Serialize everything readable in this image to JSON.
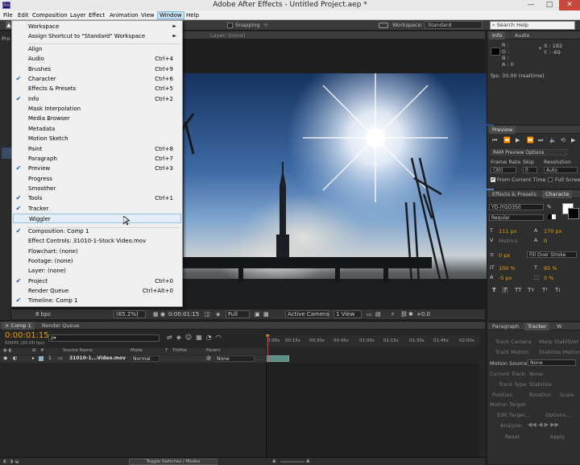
{
  "title_bar": {
    "title": "Adobe After Effects - Untitled Project.aep *",
    "minimize": "—",
    "maximize": "□",
    "close": "✕"
  },
  "menu_bar": [
    "File",
    "Edit",
    "Composition",
    "Layer",
    "Effect",
    "Animation",
    "View",
    "Window",
    "Help"
  ],
  "toolbar": {
    "snapping": "Snapping",
    "workspace_label": "Workspace:",
    "workspace_value": "Standard",
    "search_placeholder": "Search Help"
  },
  "window_menu": {
    "workspace": "Workspace",
    "assign_shortcut": "Assign Shortcut to \"Standard\" Workspace",
    "items": [
      {
        "label": "Align",
        "shortcut": "",
        "checked": false
      },
      {
        "label": "Audio",
        "shortcut": "Ctrl+4",
        "checked": false
      },
      {
        "label": "Brushes",
        "shortcut": "Ctrl+9",
        "checked": false
      },
      {
        "label": "Character",
        "shortcut": "Ctrl+6",
        "checked": true
      },
      {
        "label": "Effects & Presets",
        "shortcut": "Ctrl+5",
        "checked": false
      },
      {
        "label": "Info",
        "shortcut": "Ctrl+2",
        "checked": true
      },
      {
        "label": "Mask Interpolation",
        "shortcut": "",
        "checked": false
      },
      {
        "label": "Media Browser",
        "shortcut": "",
        "checked": false
      },
      {
        "label": "Metadata",
        "shortcut": "",
        "checked": false
      },
      {
        "label": "Motion Sketch",
        "shortcut": "",
        "checked": false
      },
      {
        "label": "Paint",
        "shortcut": "Ctrl+8",
        "checked": false
      },
      {
        "label": "Paragraph",
        "shortcut": "Ctrl+7",
        "checked": false
      },
      {
        "label": "Preview",
        "shortcut": "Ctrl+3",
        "checked": true
      },
      {
        "label": "Progress",
        "shortcut": "",
        "checked": false
      },
      {
        "label": "Smoother",
        "shortcut": "",
        "checked": false
      },
      {
        "label": "Tools",
        "shortcut": "Ctrl+1",
        "checked": true
      },
      {
        "label": "Tracker",
        "shortcut": "",
        "checked": true
      },
      {
        "label": "Wiggler",
        "shortcut": "",
        "checked": false
      }
    ],
    "items2": [
      {
        "label": "Composition: Comp 1",
        "shortcut": "",
        "checked": true
      },
      {
        "label": "Effect Controls: 31010-1-Stock Video.mov",
        "shortcut": "",
        "checked": false
      },
      {
        "label": "Flowchart: (none)",
        "shortcut": "",
        "checked": false
      },
      {
        "label": "Footage: (none)",
        "shortcut": "",
        "checked": false
      },
      {
        "label": "Layer: (none)",
        "shortcut": "",
        "checked": false
      },
      {
        "label": "Project",
        "shortcut": "Ctrl+0",
        "checked": true
      },
      {
        "label": "Render Queue",
        "shortcut": "Ctrl+Alt+0",
        "checked": false
      },
      {
        "label": "Timeline: Comp 1",
        "shortcut": "",
        "checked": true
      }
    ]
  },
  "viewer": {
    "layer_tab": "Layer: (none)",
    "bpc": "8 bpc",
    "zoom": "(65.2%)",
    "timecode": "0:00:01:15",
    "resolution": "Full",
    "camera": "Active Camera",
    "view": "1 View",
    "exposure": "+0.0"
  },
  "info_panel": {
    "tabs": [
      "Info",
      "Audio"
    ],
    "r": "R :",
    "g": "G :",
    "b": "B :",
    "a": "A : 0",
    "x": "X : 182",
    "y": "Y : -69",
    "fps": "fps: 30.00 (realtime)"
  },
  "preview_panel": {
    "tab": "Preview",
    "ram_preview": "RAM Preview Options",
    "frame_rate_label": "Frame Rate",
    "skip_label": "Skip",
    "resolution_label": "Resolution",
    "frame_rate": "(30)",
    "skip": "0",
    "resolution": "Auto",
    "from_current": "From Current Time",
    "full_screen": "Full Screen"
  },
  "character_panel": {
    "tabs": [
      "Effects & Presets",
      "Characte"
    ],
    "font": "YD-IYGO350",
    "style": "Regular",
    "size": "111 px",
    "leading": "170 px",
    "tracking": "0",
    "metrics": "Metrics",
    "stroke_width": "0 px",
    "stroke_type": "Fill Over Stroke",
    "vscale": "100 %",
    "hscale": "95 %",
    "baseline": "-5 px",
    "tsume": "0 %"
  },
  "tracker_panel": {
    "tabs": [
      "Paragraph",
      "Tracker",
      "W"
    ],
    "track_camera": "Track Camera",
    "warp_stabilizer": "Warp Stabilizer",
    "track_motion": "Track Motion",
    "stabilize_motion": "Stabilize Motion",
    "motion_source_label": "Motion Source:",
    "motion_source": "None",
    "current_track": "Current Track:",
    "current_track_value": "None",
    "track_type": "Track Type:",
    "track_type_value": "Stabilize",
    "position": "Position",
    "rotation": "Rotation",
    "scale": "Scale",
    "motion_target": "Motion Target:",
    "edit_target": "Edit Target...",
    "options": "Options...",
    "analyze": "Analyze:",
    "reset": "Reset",
    "apply": "Apply"
  },
  "timeline": {
    "tabs": [
      "Comp 1",
      "Render Queue"
    ],
    "timecode": "0:00:01:15",
    "fps_note": "00045 (30.00 fps)",
    "search_placeholder": "ρ▾",
    "col_source": "Source Name",
    "col_mode": "Mode",
    "col_t": "T",
    "col_trkmat": "TrkMat",
    "col_parent": "Parent",
    "layer_num": "1",
    "layer_name": "31010-1...Video.mov",
    "layer_mode": "Normal",
    "layer_parent": "None",
    "ticks": [
      "0:00s",
      "00:15s",
      "00:30s",
      "00:45s",
      "01:00s",
      "01:15s",
      "01:30s",
      "01:45s",
      "02:00s"
    ],
    "toggle": "Toggle Switches / Modes"
  },
  "left_strip": {
    "label": "Pro"
  }
}
